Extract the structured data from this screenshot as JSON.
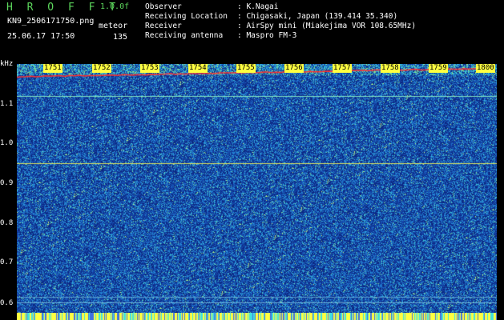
{
  "header": {
    "brand": "H R O F F T",
    "version": "1.0.0f",
    "filename": "KN9_2506171750.png",
    "mode": "meteor",
    "datetime": "25.06.17 17:50",
    "count": "135",
    "info": [
      {
        "label": "Observer",
        "value": ": K.Nagai"
      },
      {
        "label": "Receiving Location",
        "value": ": Chigasaki, Japan (139.414 35.340)"
      },
      {
        "label": "Receiver",
        "value": ": AirSpy mini (Miakejima VOR 108.65MHz)"
      },
      {
        "label": "Receiving antenna",
        "value": ": Maspro FM-3"
      }
    ]
  },
  "axis": {
    "unit": "kHz",
    "y_labels": [
      "1.1",
      "1.0",
      "0.9",
      "0.8",
      "0.7",
      "0.6"
    ],
    "time_labels": [
      "1751",
      "1752",
      "1753",
      "1754",
      "1755",
      "1756",
      "1757",
      "1758",
      "1759",
      "1800"
    ]
  },
  "colors": {
    "background": "#000000",
    "brand": "#5cd65c",
    "noise_base": "#1c4fa2",
    "trace": "#ff3030",
    "marker_line": "#ffff40"
  }
}
